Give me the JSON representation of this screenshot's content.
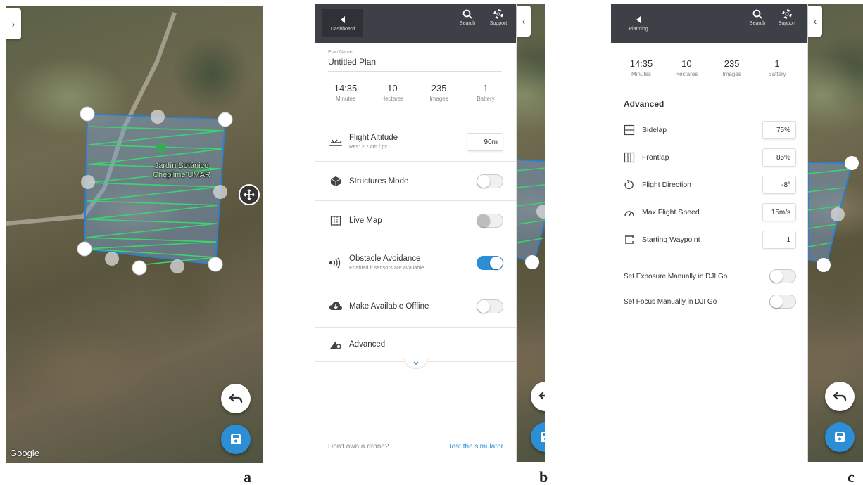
{
  "panel_a": {
    "map_label": "Jardín Botánico Chepilme UMAR",
    "google_logo": "Google",
    "expand_icon": "chevron-right-icon"
  },
  "panel_b": {
    "topbar": {
      "back_label": "Dashboard",
      "search_label": "Search",
      "support_label": "Support"
    },
    "plan_name_label": "Plan Name",
    "plan_name_value": "Untitled Plan",
    "stats": [
      {
        "num": "14:35",
        "unit": "Minutes"
      },
      {
        "num": "10",
        "unit": "Hectares"
      },
      {
        "num": "235",
        "unit": "Images"
      },
      {
        "num": "1",
        "unit": "Battery"
      }
    ],
    "flight_altitude": {
      "title": "Flight Altitude",
      "sub": "Res: 2.7 cm / px",
      "value": "90m"
    },
    "structures_mode": {
      "title": "Structures Mode",
      "on": false
    },
    "live_map": {
      "title": "Live Map",
      "on": false,
      "disabled": true
    },
    "obstacle_avoidance": {
      "title": "Obstacle Avoidance",
      "sub": "Enabled if sensors are available",
      "on": true
    },
    "offline": {
      "title": "Make Available Offline",
      "on": false
    },
    "advanced": {
      "title": "Advanced"
    },
    "footer": {
      "question": "Don't own a drone?",
      "link": "Test the simulator"
    }
  },
  "panel_c": {
    "topbar": {
      "back_label": "Planning",
      "search_label": "Search",
      "support_label": "Support"
    },
    "stats": [
      {
        "num": "14:35",
        "unit": "Minutes"
      },
      {
        "num": "10",
        "unit": "Hectares"
      },
      {
        "num": "235",
        "unit": "Images"
      },
      {
        "num": "1",
        "unit": "Battery"
      }
    ],
    "advanced_heading": "Advanced",
    "settings": [
      {
        "title": "Sidelap",
        "value": "75%",
        "icon": "sidelap-icon"
      },
      {
        "title": "Frontlap",
        "value": "85%",
        "icon": "frontlap-icon"
      },
      {
        "title": "Flight Direction",
        "value": "-8°",
        "icon": "flight-direction-icon"
      },
      {
        "title": "Max Flight Speed",
        "value": "15m/s",
        "icon": "speed-gauge-icon"
      },
      {
        "title": "Starting Waypoint",
        "value": "1",
        "icon": "waypoint-icon"
      }
    ],
    "toggles": [
      {
        "title": "Set Exposure Manually in DJI Go",
        "on": false
      },
      {
        "title": "Set Focus Manually in DJI Go",
        "on": false
      }
    ]
  },
  "captions": {
    "a": "a",
    "b": "b",
    "c": "c"
  },
  "colors": {
    "accent": "#2c8fd6",
    "topbar": "#3d4047",
    "flight_path": "#3bd46f",
    "polygon_edge": "#2d7fd0"
  }
}
